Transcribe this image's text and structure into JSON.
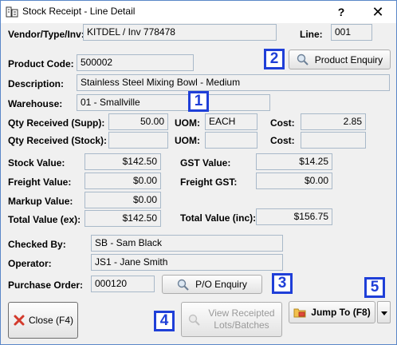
{
  "window": {
    "title": "Stock Receipt - Line Detail",
    "help_label": "?",
    "close_label": "✕"
  },
  "vendor": {
    "label": "Vendor/Type/Inv:",
    "value": "KITDEL / Inv 778478"
  },
  "line": {
    "label": "Line:",
    "value": "001"
  },
  "product_code": {
    "label": "Product Code:",
    "value": "500002"
  },
  "product_enquiry": {
    "label": "Product Enquiry"
  },
  "description": {
    "label": "Description:",
    "value": "Stainless Steel Mixing Bowl - Medium"
  },
  "warehouse": {
    "label": "Warehouse:",
    "value": "01 - Smallville"
  },
  "qty_supp": {
    "label": "Qty Received (Supp):",
    "value": "50.00"
  },
  "uom_supp": {
    "label": "UOM:",
    "value": "EACH"
  },
  "cost_supp": {
    "label": "Cost:",
    "value": "2.85"
  },
  "qty_stock": {
    "label": "Qty Received (Stock):",
    "value": ""
  },
  "uom_stock": {
    "label": "UOM:",
    "value": ""
  },
  "cost_stock": {
    "label": "Cost:",
    "value": ""
  },
  "stock_value": {
    "label": "Stock Value:",
    "value": "$142.50"
  },
  "gst_value": {
    "label": "GST Value:",
    "value": "$14.25"
  },
  "freight_value": {
    "label": "Freight Value:",
    "value": "$0.00"
  },
  "freight_gst": {
    "label": "Freight GST:",
    "value": "$0.00"
  },
  "markup_value": {
    "label": "Markup Value:",
    "value": "$0.00"
  },
  "total_ex": {
    "label": "Total Value (ex):",
    "value": "$142.50"
  },
  "total_inc": {
    "label": "Total Value (inc):",
    "value": "$156.75"
  },
  "checked_by": {
    "label": "Checked By:",
    "value": "SB - Sam Black"
  },
  "operator": {
    "label": "Operator:",
    "value": "JS1 - Jane Smith"
  },
  "purchase_order": {
    "label": "Purchase Order:",
    "value": "000120"
  },
  "po_enquiry": {
    "label": "P/O Enquiry"
  },
  "close_button": {
    "label": "Close (F4)"
  },
  "view_lots": {
    "line1": "View Receipted",
    "line2": "Lots/Batches"
  },
  "jump_to": {
    "label": "Jump To (F8)"
  },
  "markers": {
    "m1": "1",
    "m2": "2",
    "m3": "3",
    "m4": "4",
    "m5": "5"
  },
  "colors": {
    "marker": "#1f3fd8",
    "field_border": "#a9b9c9",
    "background": "#f0f0f0"
  }
}
